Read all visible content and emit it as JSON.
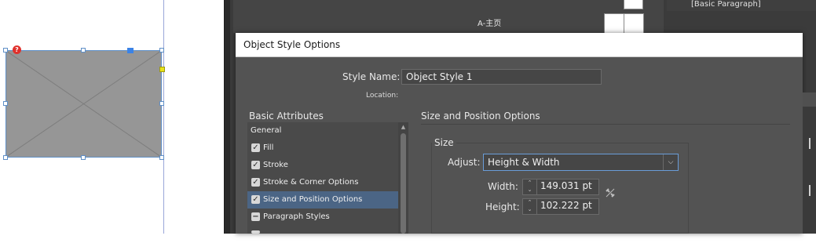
{
  "canvas": {
    "warning_badge": "?"
  },
  "pages_panel": {
    "master_label": "A-主页"
  },
  "paragraph_styles_panel": {
    "label": "[Basic Paragraph]"
  },
  "dialog": {
    "title": "Object Style Options",
    "style_name_label": "Style Name:",
    "style_name_value": "Object Style 1",
    "location_label": "Location:",
    "basic_attributes_header": "Basic Attributes",
    "attributes": [
      {
        "label": "General",
        "checkbox": false,
        "state": "none"
      },
      {
        "label": "Fill",
        "checkbox": true,
        "state": "checked"
      },
      {
        "label": "Stroke",
        "checkbox": true,
        "state": "checked"
      },
      {
        "label": "Stroke & Corner Options",
        "checkbox": true,
        "state": "checked"
      },
      {
        "label": "Size and Position Options",
        "checkbox": true,
        "state": "checked",
        "selected": true
      },
      {
        "label": "Paragraph Styles",
        "checkbox": true,
        "state": "ignored"
      }
    ],
    "section_title": "Size and Position Options",
    "size_group_label": "Size",
    "adjust_label": "Adjust:",
    "adjust_value": "Height & Width",
    "width_label": "Width:",
    "width_value": "149.031 pt",
    "height_label": "Height:",
    "height_value": "102.222 pt"
  },
  "icons": {
    "checkbox": "check-icon",
    "dropdown": "chevron-down-icon",
    "spinner": "stepper-arrows-icon",
    "constrain": "broken-link-icon"
  },
  "colors": {
    "dialog_bg": "#535353",
    "selection": "#4b6585",
    "frame_fill": "#969696",
    "frame_border": "#5f8fc7",
    "focus_border": "#6a9dd8"
  }
}
